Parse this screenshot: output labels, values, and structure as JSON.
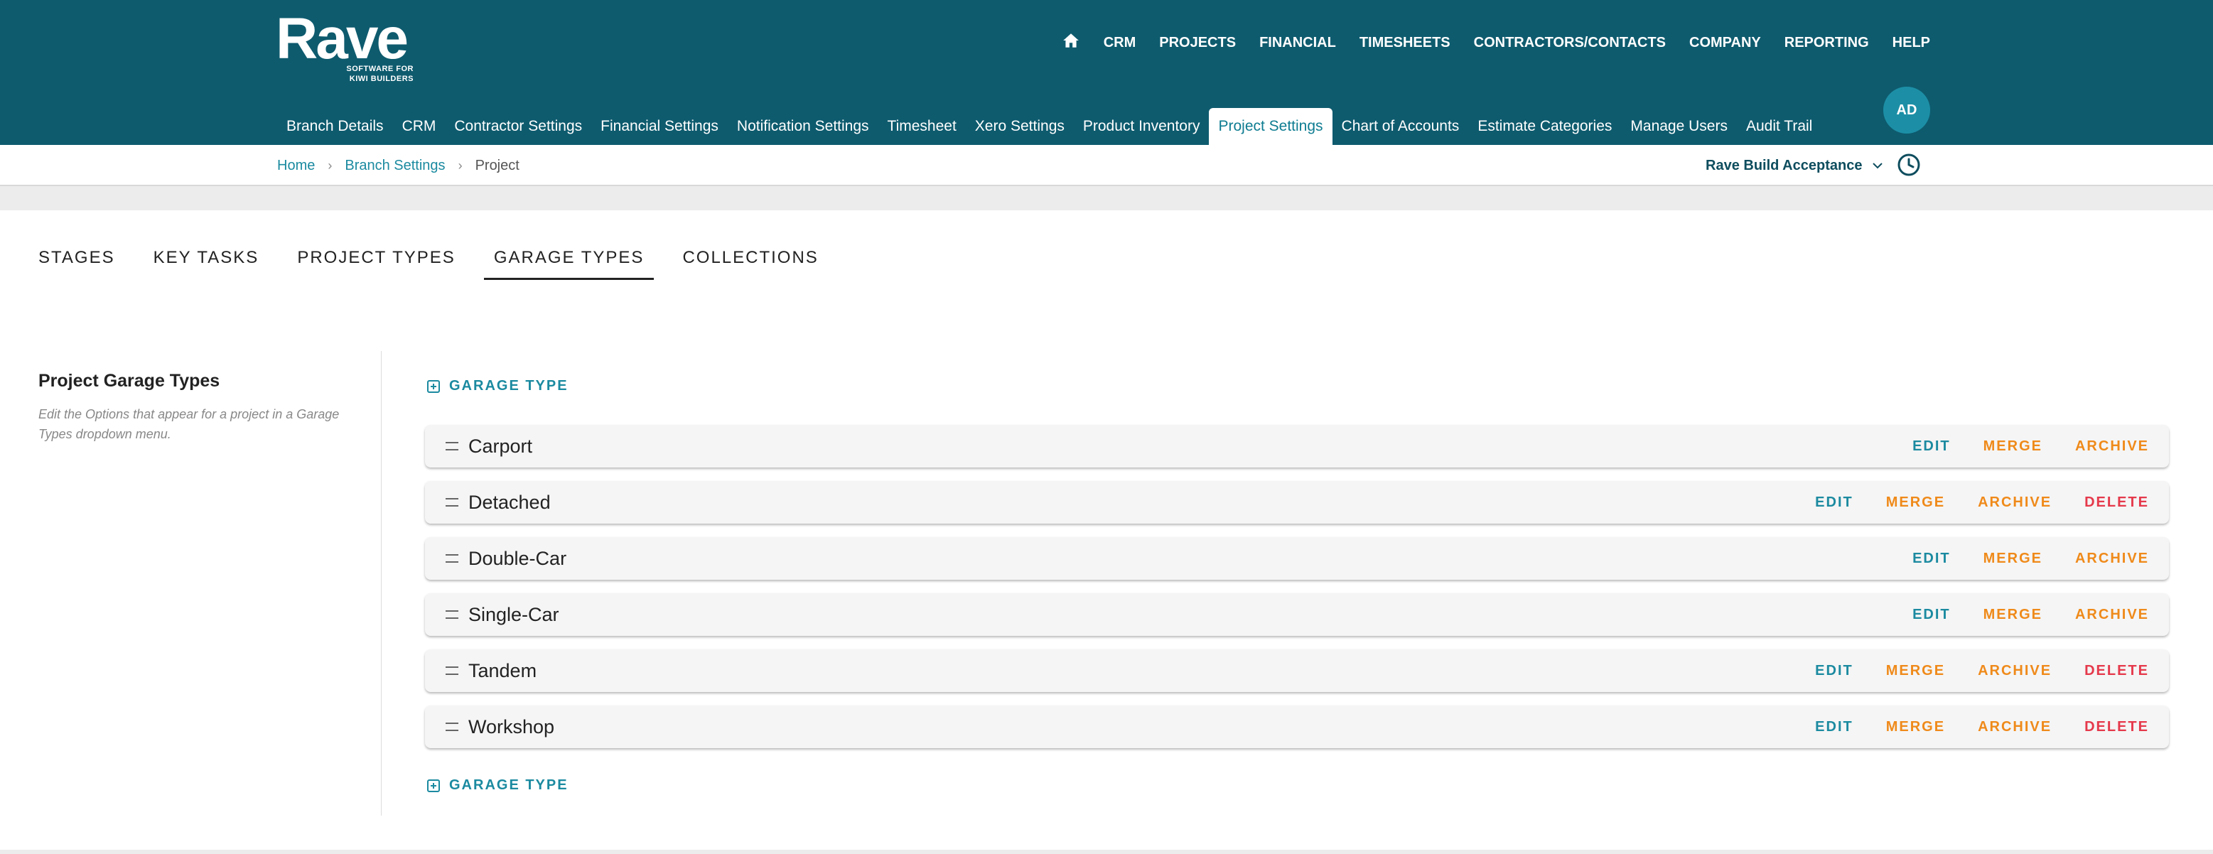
{
  "brand": {
    "name": "Rave",
    "tagline_line1": "SOFTWARE FOR",
    "tagline_line2": "KIWI BUILDERS"
  },
  "topnav": [
    "CRM",
    "PROJECTS",
    "FINANCIAL",
    "TIMESHEETS",
    "CONTRACTORS/CONTACTS",
    "COMPANY",
    "REPORTING",
    "HELP"
  ],
  "user": {
    "initials": "AD"
  },
  "subnav": [
    "Branch Details",
    "CRM",
    "Contractor Settings",
    "Financial Settings",
    "Notification Settings",
    "Timesheet",
    "Xero Settings",
    "Product Inventory",
    "Project Settings",
    "Chart of Accounts",
    "Estimate Categories",
    "Manage Users",
    "Audit Trail"
  ],
  "breadcrumb": {
    "home": "Home",
    "branch": "Branch Settings",
    "current": "Project"
  },
  "branch_select": "Rave Build Acceptance",
  "tabs": [
    "STAGES",
    "KEY TASKS",
    "PROJECT TYPES",
    "GARAGE TYPES",
    "COLLECTIONS"
  ],
  "section": {
    "title": "Project Garage Types",
    "description": "Edit the Options that appear for a project in a Garage Types dropdown menu."
  },
  "add_label": "GARAGE TYPE",
  "actions": {
    "edit": "EDIT",
    "merge": "MERGE",
    "archive": "ARCHIVE",
    "delete": "DELETE"
  },
  "garage_types": [
    {
      "name": "Carport",
      "deletable": false
    },
    {
      "name": "Detached",
      "deletable": true
    },
    {
      "name": "Double-Car",
      "deletable": false
    },
    {
      "name": "Single-Car",
      "deletable": false
    },
    {
      "name": "Tandem",
      "deletable": true
    },
    {
      "name": "Workshop",
      "deletable": true
    }
  ],
  "colors": {
    "header": "#0e5b6e",
    "accent": "#1b8aa0",
    "merge": "#ef8a1a",
    "delete": "#e5394b"
  }
}
